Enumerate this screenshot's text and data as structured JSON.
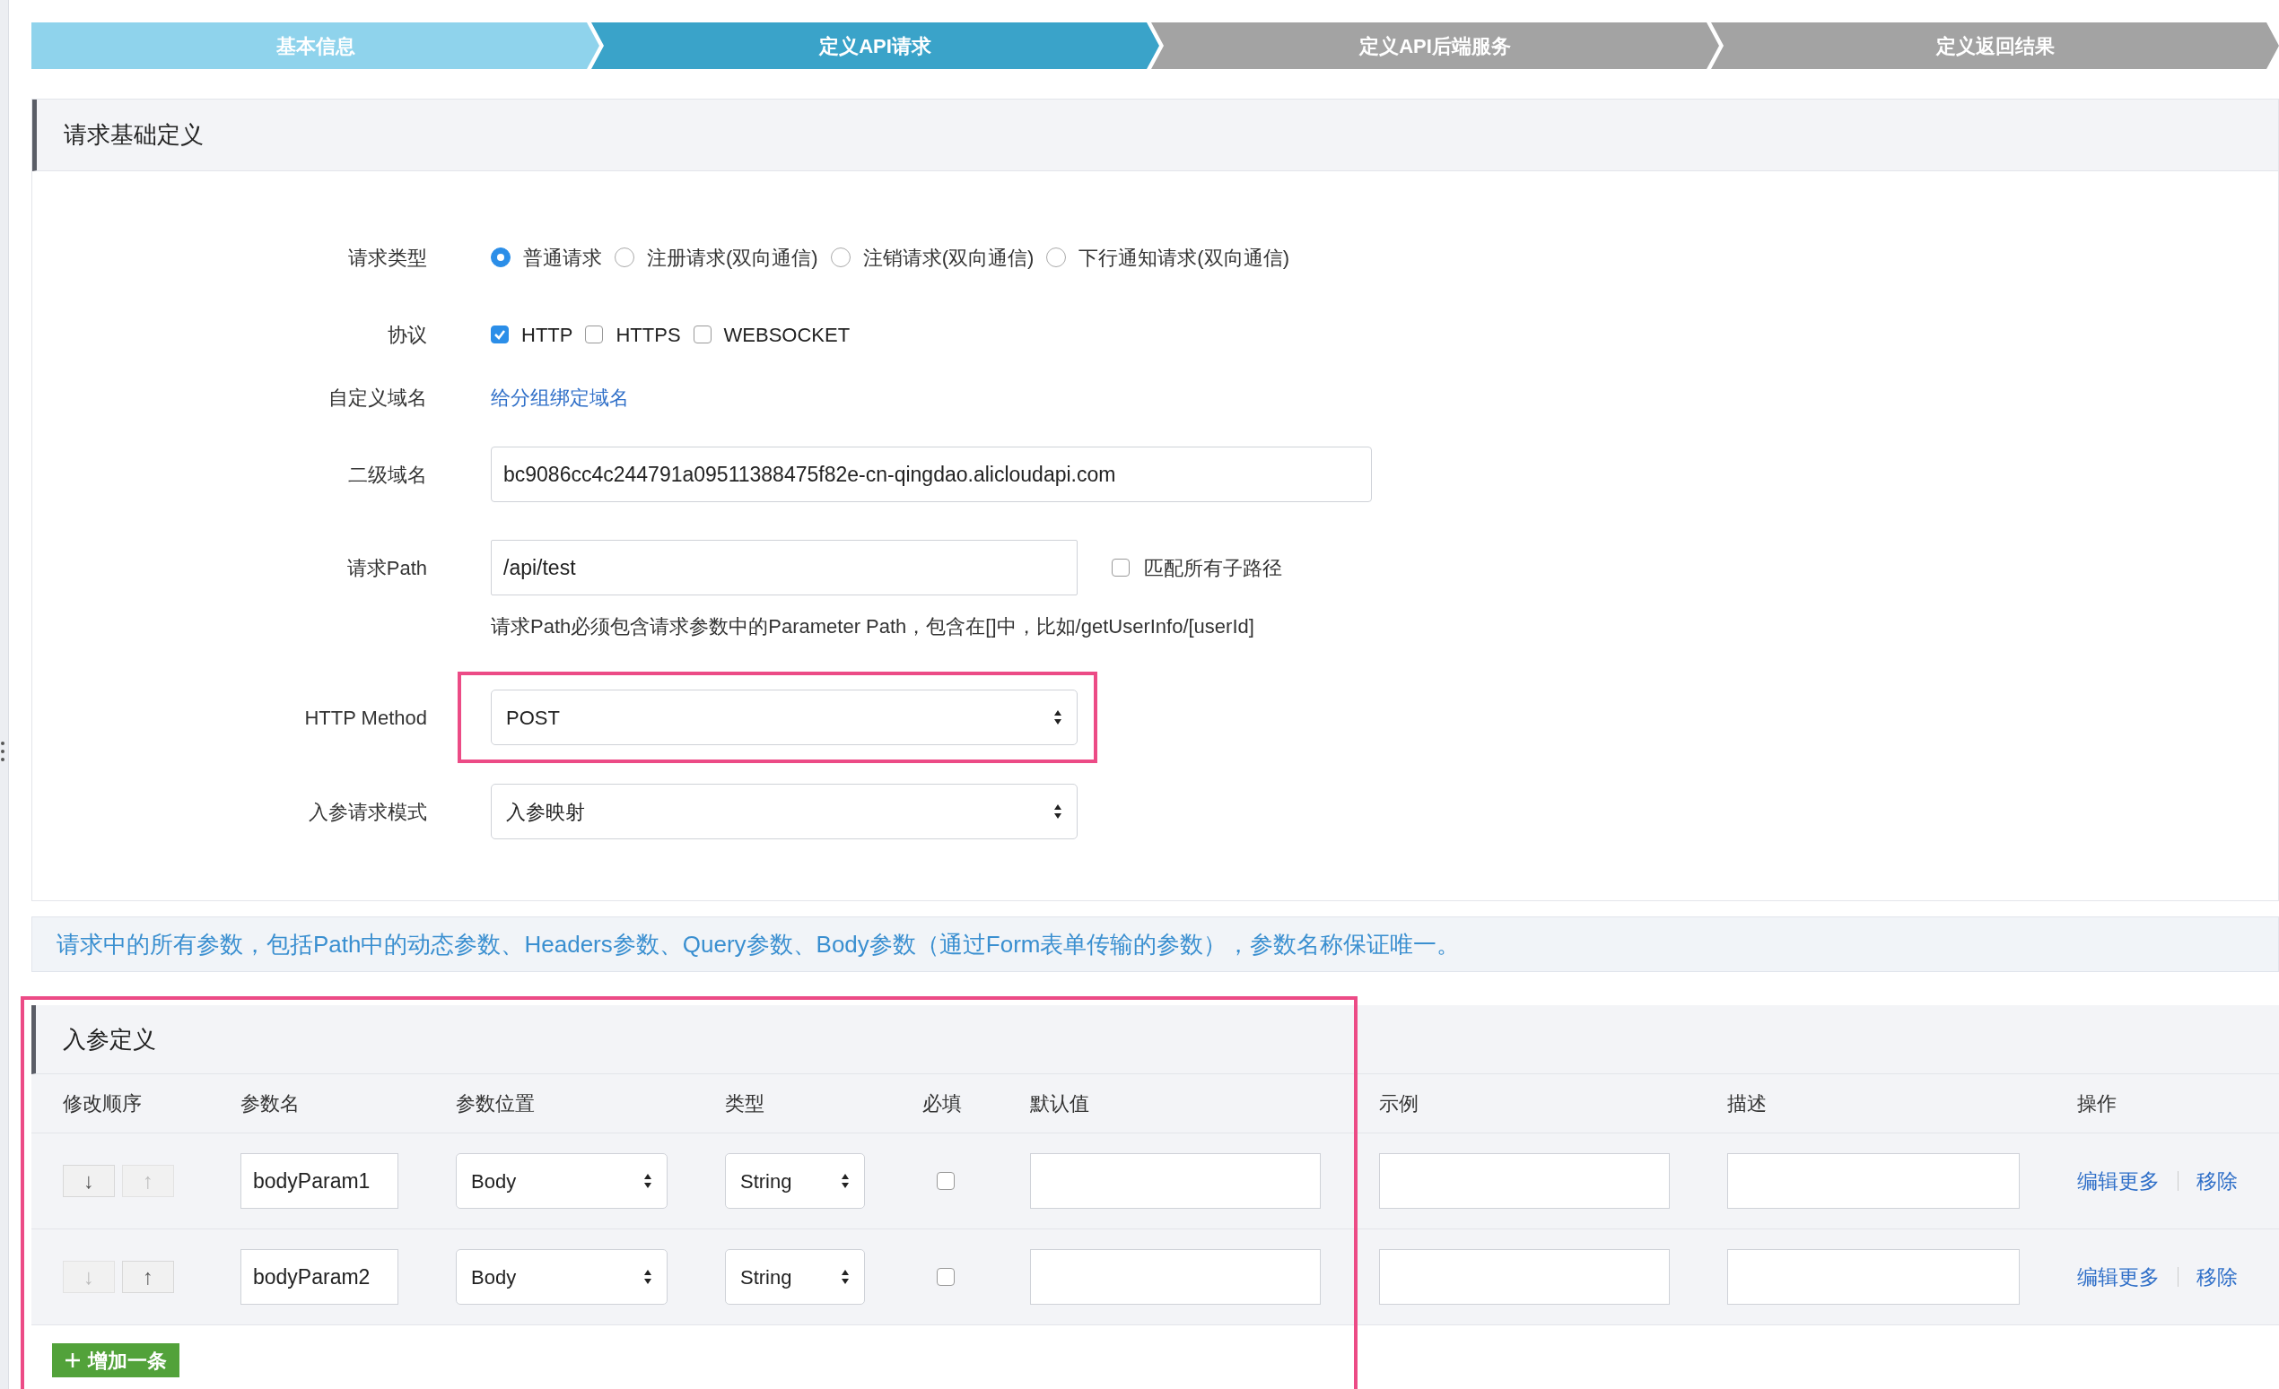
{
  "steps": [
    {
      "label": "基本信息",
      "selected": false
    },
    {
      "label": "定义API请求",
      "selected": true
    },
    {
      "label": "定义API后端服务",
      "selected": false
    },
    {
      "label": "定义返回结果",
      "selected": false
    }
  ],
  "basic_section": {
    "title": "请求基础定义"
  },
  "form": {
    "request_type": {
      "label": "请求类型",
      "options": [
        {
          "label": "普通请求",
          "selected": true
        },
        {
          "label": "注册请求(双向通信)",
          "selected": false
        },
        {
          "label": "注销请求(双向通信)",
          "selected": false
        },
        {
          "label": "下行通知请求(双向通信)",
          "selected": false
        }
      ]
    },
    "protocol": {
      "label": "协议",
      "options": [
        {
          "label": "HTTP",
          "checked": true
        },
        {
          "label": "HTTPS",
          "checked": false
        },
        {
          "label": "WEBSOCKET",
          "checked": false
        }
      ]
    },
    "custom_domain": {
      "label": "自定义域名",
      "link": "给分组绑定域名"
    },
    "subdomain": {
      "label": "二级域名",
      "value": "bc9086cc4c244791a09511388475f82e-cn-qingdao.alicloudapi.com"
    },
    "path": {
      "label": "请求Path",
      "value": "/api/test",
      "match_all": {
        "label": "匹配所有子路径",
        "checked": false
      },
      "hint": "请求Path必须包含请求参数中的Parameter Path，包含在[]中，比如/getUserInfo/[userId]"
    },
    "http_method": {
      "label": "HTTP Method",
      "value": "POST",
      "highlighted": true
    },
    "param_mode": {
      "label": "入参请求模式",
      "value": "入参映射"
    }
  },
  "info_banner": "请求中的所有参数，包括Path中的动态参数、Headers参数、Query参数、Body参数（通过Form表单传输的参数），参数名称保证唯一。",
  "params": {
    "title": "入参定义",
    "highlighted": true,
    "columns": [
      "修改顺序",
      "参数名",
      "参数位置",
      "类型",
      "必填",
      "默认值",
      "示例",
      "描述",
      "操作"
    ],
    "rows": [
      {
        "down": {
          "glyph": "↓",
          "disabled": false
        },
        "up": {
          "glyph": "↑",
          "disabled": true
        },
        "name": "bodyParam1",
        "location": "Body",
        "type": "String",
        "required": false,
        "actions": [
          "编辑更多",
          "移除"
        ]
      },
      {
        "down": {
          "glyph": "↓",
          "disabled": true
        },
        "up": {
          "glyph": "↑",
          "disabled": false
        },
        "name": "bodyParam2",
        "location": "Body",
        "type": "String",
        "required": false,
        "actions": [
          "编辑更多",
          "移除"
        ]
      }
    ],
    "add_button": {
      "label": "增加一条"
    }
  }
}
